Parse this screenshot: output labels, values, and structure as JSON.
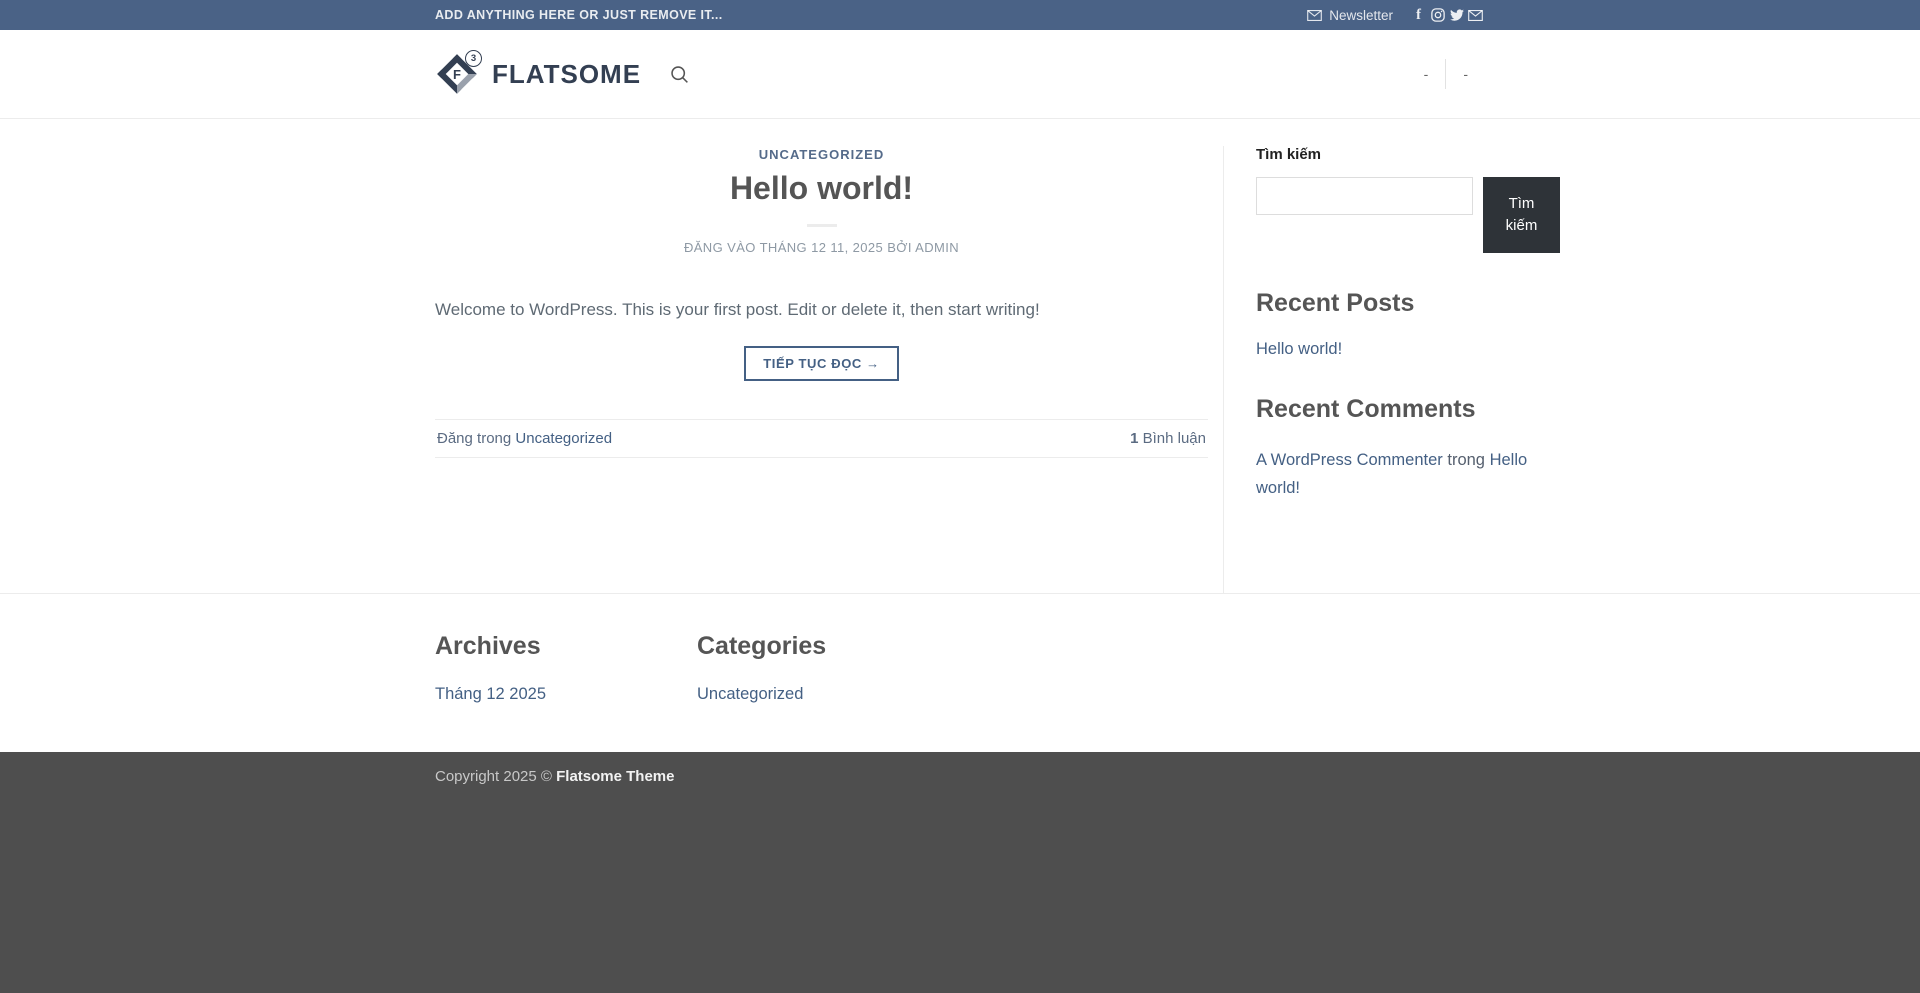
{
  "topbar": {
    "message": "ADD ANYTHING HERE OR JUST REMOVE IT...",
    "newsletter_label": "Newsletter",
    "facebook_glyph": "f",
    "social_icons": [
      "newsletter-envelope",
      "facebook",
      "instagram",
      "twitter",
      "email"
    ]
  },
  "header": {
    "logo_text": "FLATSOME",
    "logo_letter": "F",
    "logo_badge": "3",
    "nav_items": [
      {
        "label": "-"
      },
      {
        "label": "-"
      }
    ]
  },
  "post": {
    "category": "UNCATEGORIZED",
    "title": "Hello world!",
    "meta_prefix": "ĐĂNG VÀO",
    "meta_date": "THÁNG 12 11, 2025",
    "meta_by": "BỞI",
    "meta_author": "ADMIN",
    "excerpt": "Welcome to WordPress. This is your first post. Edit or delete it, then start writing!",
    "read_more": "TIẾP TỤC ĐỌC →",
    "posted_in_prefix": "Đăng trong",
    "posted_in_link": "Uncategorized",
    "comments_count": "1",
    "comments_label": "Bình luận"
  },
  "sidebar": {
    "search": {
      "label": "Tìm kiếm",
      "value": "",
      "placeholder": "",
      "button": "Tìm kiếm"
    },
    "recent_posts": {
      "title": "Recent Posts",
      "items": [
        "Hello world!"
      ]
    },
    "recent_comments": {
      "title": "Recent Comments",
      "author": "A WordPress Commenter",
      "connector": "trong",
      "post": "Hello world!"
    }
  },
  "footer": {
    "archives": {
      "title": "Archives",
      "links": [
        "Tháng 12 2025"
      ]
    },
    "categories": {
      "title": "Categories",
      "links": [
        "Uncategorized"
      ]
    },
    "copyright_prefix": "Copyright 2025 ©",
    "copyright_brand": "Flatsome Theme"
  },
  "colors": {
    "topbar_bg": "#4a6286",
    "primary": "#446084",
    "logo_navy": "#333f52",
    "search_button_bg": "#2e3338",
    "dark_footer_bg": "#4e4e4e",
    "divider": "#ececec"
  }
}
